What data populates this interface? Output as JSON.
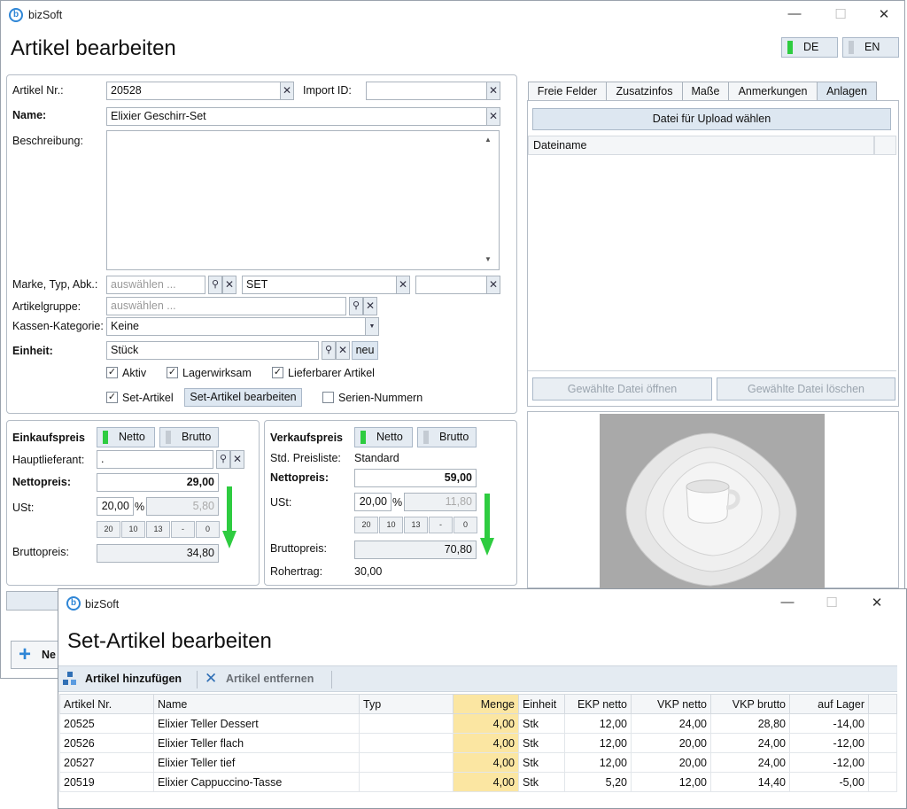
{
  "main_window": {
    "app_name": "bizSoft",
    "title": "Artikel bearbeiten",
    "controls": {
      "minimize": "—",
      "maximize": "☐",
      "close": "✕"
    },
    "lang": [
      {
        "label": "DE",
        "active": true
      },
      {
        "label": "EN",
        "active": false
      }
    ],
    "form": {
      "artikel_nr_label": "Artikel Nr.:",
      "artikel_nr": "20528",
      "import_id_label": "Import ID:",
      "import_id": "",
      "name_label": "Name:",
      "name": "Elixier Geschirr-Set",
      "beschreibung_label": "Beschreibung:",
      "beschreibung": "",
      "marke_label": "Marke, Typ, Abk.:",
      "marke_placeholder": "auswählen ...",
      "typ": "SET",
      "abk": "",
      "artikelgruppe_label": "Artikelgruppe:",
      "artikelgruppe_placeholder": "auswählen ...",
      "kassen_label": "Kassen-Kategorie:",
      "kassen_value": "Keine",
      "einheit_label": "Einheit:",
      "einheit_value": "Stück",
      "einheit_new": "neu",
      "checkbox_aktiv": "Aktiv",
      "checkbox_lager": "Lagerwirksam",
      "checkbox_liefer": "Lieferbarer Artikel",
      "checkbox_set": "Set-Artikel",
      "set_edit_button": "Set-Artikel bearbeiten",
      "checkbox_serien": "Serien-Nummern"
    },
    "einkauf": {
      "title": "Einkaufspreis",
      "netto": "Netto",
      "brutto": "Brutto",
      "lieferant_label": "Hauptlieferant:",
      "lieferant": ".",
      "netto_label": "Nettopreis:",
      "netto_value": "29,00",
      "ust_label": "USt:",
      "ust_rate": "20,00",
      "percent": "%",
      "ust_amount": "5,80",
      "brutto_label": "Bruttopreis:",
      "brutto_value": "34,80"
    },
    "verkauf": {
      "title": "Verkaufspreis",
      "netto": "Netto",
      "brutto": "Brutto",
      "preisliste_label": "Std. Preisliste:",
      "preisliste": "Standard",
      "netto_label": "Nettopreis:",
      "netto_value": "59,00",
      "ust_label": "USt:",
      "ust_rate": "20,00",
      "percent": "%",
      "ust_amount": "11,80",
      "brutto_label": "Bruttopreis:",
      "brutto_value": "70,80",
      "rohertrag_label": "Rohertrag:",
      "rohertrag": "30,00"
    },
    "vat_buttons": [
      "20",
      "10",
      "13",
      "-",
      "0"
    ],
    "tabs": [
      "Freie Felder",
      "Zusatzinfos",
      "Maße",
      "Anmerkungen",
      "Anlagen"
    ],
    "upload_button": "Datei für Upload wählen",
    "file_column": "Dateiname",
    "open_button": "Gewählte Datei öffnen",
    "delete_button": "Gewählte Datei löschen",
    "bottom_button_partial": "Ne",
    "colors": {
      "accent_green": "#2ecc40",
      "button_blue": "#dde7f1",
      "qty_yellow": "#fbe6a2"
    }
  },
  "set_window": {
    "app_name": "bizSoft",
    "title": "Set-Artikel bearbeiten",
    "add_button": "Artikel hinzufügen",
    "remove_button": "Artikel entfernen",
    "columns": [
      "Artikel Nr.",
      "Name",
      "Typ",
      "Menge",
      "Einheit",
      "EKP netto",
      "VKP netto",
      "VKP brutto",
      "auf Lager"
    ],
    "rows": [
      {
        "nr": "20525",
        "name": "Elixier Teller Dessert",
        "typ": "",
        "menge": "4,00",
        "einheit": "Stk",
        "ekp": "12,00",
        "vkp": "24,00",
        "vkpb": "28,80",
        "lager": "-14,00"
      },
      {
        "nr": "20526",
        "name": "Elixier Teller flach",
        "typ": "",
        "menge": "4,00",
        "einheit": "Stk",
        "ekp": "12,00",
        "vkp": "20,00",
        "vkpb": "24,00",
        "lager": "-12,00"
      },
      {
        "nr": "20527",
        "name": "Elixier Teller tief",
        "typ": "",
        "menge": "4,00",
        "einheit": "Stk",
        "ekp": "12,00",
        "vkp": "20,00",
        "vkpb": "24,00",
        "lager": "-12,00"
      },
      {
        "nr": "20519",
        "name": "Elixier Cappuccino-Tasse",
        "typ": "",
        "menge": "4,00",
        "einheit": "Stk",
        "ekp": "5,20",
        "vkp": "12,00",
        "vkpb": "14,40",
        "lager": "-5,00"
      }
    ]
  }
}
